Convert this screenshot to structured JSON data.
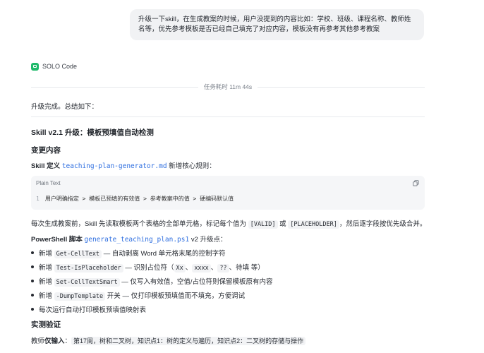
{
  "user_message": "升级一下skill，在生成教案的时候，用户没提到的内容比如：学校、班级、课程名称、教师姓名等，优先参考模板是否已经自己填充了对应内容，模板没有再参考其他参考教案",
  "agent": {
    "name": "SOLO Code"
  },
  "task_duration": "任务耗时 11m 44s",
  "summary_intro": "升级完成。总结如下：",
  "section_title": "Skill v2.1 升级：模板预填值自动检测",
  "changes_heading": "变更内容",
  "skill_def": {
    "label": "Skill 定义",
    "file": "teaching-plan-generator.md",
    "suffix": "新增核心规则："
  },
  "codeblock": {
    "lang": "Plain Text",
    "line_no": "1",
    "code": "用户明确指定 > 模板已预填的有效值 > 参考教案中的值 > 硬编码默认值"
  },
  "scan_para": {
    "before": "每次生成教案前，Skill 先读取模板两个表格的全部单元格，标记每个值为 ",
    "valid": "[VALID]",
    "or": " 或 ",
    "placeholder": "[PLACEHOLDER]",
    "after": "，然后逐字段按优先级合并。"
  },
  "ps_script": {
    "label": "PowerShell 脚本",
    "file": "generate_teaching_plan.ps1",
    "suffix": " v2 升级点："
  },
  "bullets": [
    {
      "pre": "新增 ",
      "code": "Get-CellText",
      "post": " — 自动剥离 Word 单元格末尾的控制字符"
    },
    {
      "pre": "新增 ",
      "code": "Test-IsPlaceholder",
      "post": " — 识别占位符（",
      "codes": [
        "Xx",
        "xxxx",
        "??"
      ],
      "seps": [
        "、",
        "、",
        "、"
      ],
      "tail": "待填 等）"
    },
    {
      "pre": "新增 ",
      "code": "Set-CellTextSmart",
      "post": " — 仅写入有效值，空值/占位符则保留模板原有内容"
    },
    {
      "pre": "新增 ",
      "code": "-DumpTemplate",
      "post": " 开关 — 仅打印模板预填值而不填充，方便调试"
    },
    {
      "pre": "每次运行自动打印模板预填值映射表",
      "code": "",
      "post": ""
    }
  ],
  "verify_heading": "实测验证",
  "teacher_input": {
    "label": "教师仅输入",
    "colon": "：",
    "value": "第17周，树和二叉树，知识点1：树的定义与遍历，知识点2：二叉树的存储与操作"
  }
}
